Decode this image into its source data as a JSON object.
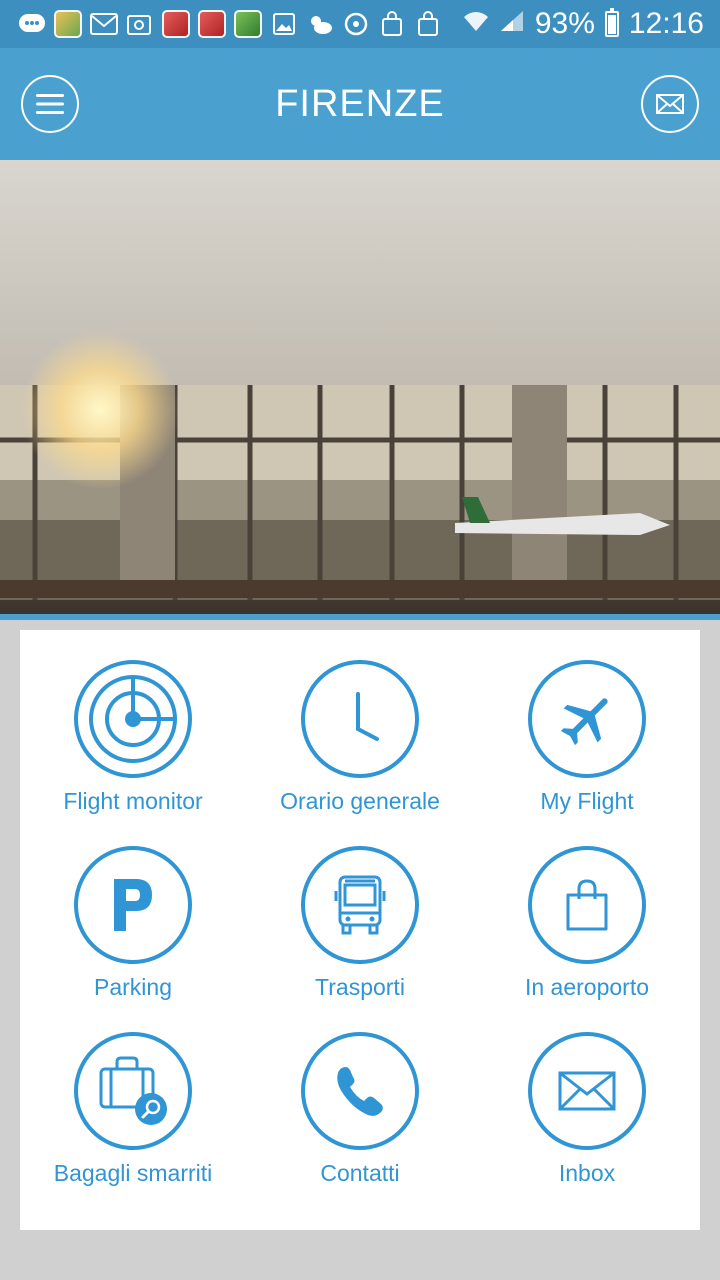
{
  "status_bar": {
    "battery": "93%",
    "time": "12:16"
  },
  "app_bar": {
    "title": "FIRENZE"
  },
  "menu": {
    "items": [
      {
        "label": "Flight monitor",
        "icon": "radar-icon"
      },
      {
        "label": "Orario generale",
        "icon": "clock-icon"
      },
      {
        "label": "My Flight",
        "icon": "airplane-icon"
      },
      {
        "label": "Parking",
        "icon": "parking-icon"
      },
      {
        "label": "Trasporti",
        "icon": "bus-icon"
      },
      {
        "label": "In aeroporto",
        "icon": "shopping-bag-icon"
      },
      {
        "label": "Bagagli smarriti",
        "icon": "lost-luggage-icon"
      },
      {
        "label": "Contatti",
        "icon": "phone-icon"
      },
      {
        "label": "Inbox",
        "icon": "envelope-icon"
      }
    ]
  },
  "colors": {
    "status_bar": "#3d8fbf",
    "app_bar": "#4aa1cf",
    "accent": "#2f95d4",
    "background": "#d0d0d0"
  }
}
